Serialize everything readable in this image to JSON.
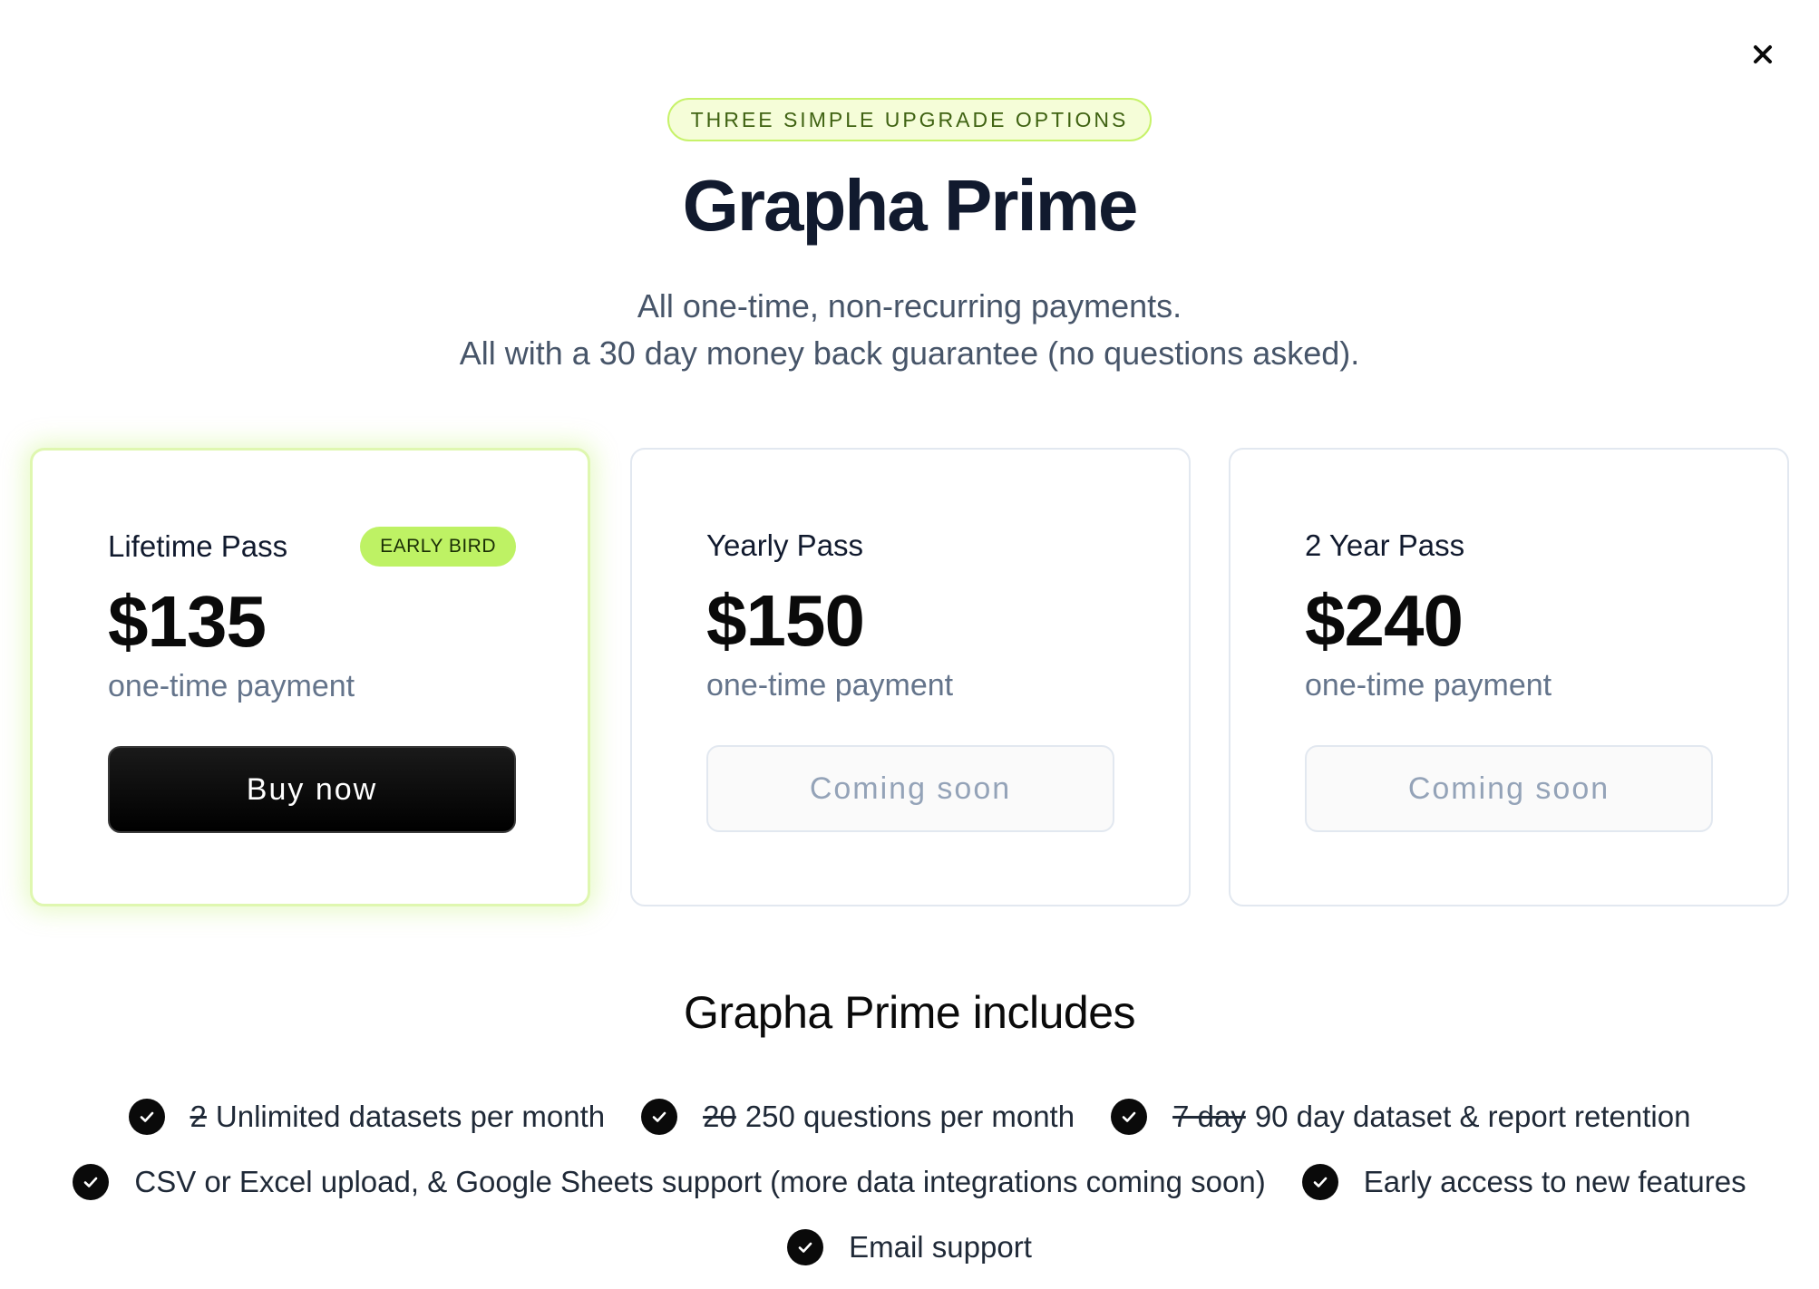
{
  "header": {
    "pill": "THREE SIMPLE UPGRADE OPTIONS",
    "title": "Grapha Prime",
    "subtitle_line1": "All one-time, non-recurring payments.",
    "subtitle_line2": "All with a 30 day money back guarantee (no questions asked)."
  },
  "plans": [
    {
      "name": "Lifetime Pass",
      "badge": "EARLY BIRD",
      "price": "$135",
      "note": "one-time payment",
      "cta": "Buy now"
    },
    {
      "name": "Yearly Pass",
      "price": "$150",
      "note": "one-time payment",
      "cta": "Coming soon"
    },
    {
      "name": "2 Year Pass",
      "price": "$240",
      "note": "one-time payment",
      "cta": "Coming soon"
    }
  ],
  "includes": {
    "title": "Grapha Prime includes",
    "features": [
      {
        "old": "2",
        "text": "Unlimited datasets per month"
      },
      {
        "old": "20",
        "text": "250 questions per month"
      },
      {
        "old": "7 day",
        "text": "90 day dataset & report retention"
      },
      {
        "text": "CSV or Excel upload, & Google Sheets support (more data integrations coming soon)"
      },
      {
        "text": "Early access to new features"
      },
      {
        "text": "Email support"
      }
    ]
  },
  "colors": {
    "accent": "#bef264",
    "pill_border": "#c7f26a",
    "pill_text": "#3f6212",
    "title": "#111a2e",
    "muted": "#64748b"
  },
  "icons": {
    "close": "close-icon",
    "check": "check-circle-icon"
  }
}
